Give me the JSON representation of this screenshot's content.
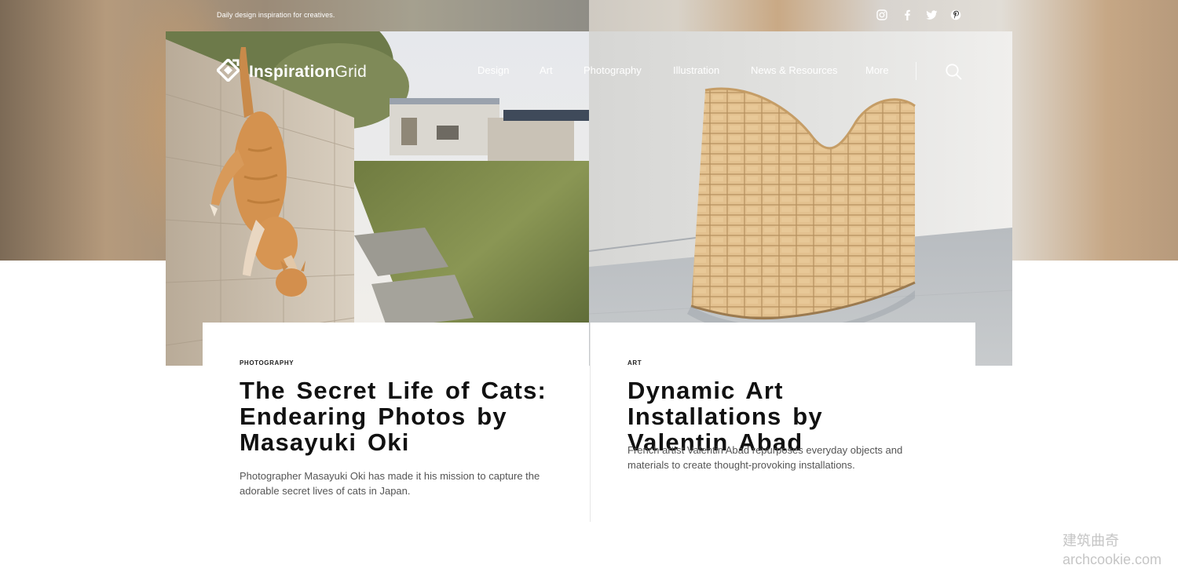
{
  "topbar": {
    "tagline": "Daily design inspiration for creatives.",
    "social": [
      {
        "icon": "instagram-icon"
      },
      {
        "icon": "facebook-icon"
      },
      {
        "icon": "twitter-icon"
      },
      {
        "icon": "pinterest-icon"
      }
    ]
  },
  "logo": {
    "bold": "Inspiration",
    "light": "Grid"
  },
  "nav": {
    "items": [
      "Design",
      "Art",
      "Photography",
      "Illustration",
      "News & Resources",
      "More"
    ],
    "search_icon": "search-icon"
  },
  "posts": [
    {
      "category": "Photography",
      "title": "The Secret Life of Cats: Endearing Photos by Masayuki Oki",
      "description": "Photographer Masayuki Oki has made it his mission to capture the adorable secret lives of cats in Japan."
    },
    {
      "category": "Art",
      "title": "Dynamic Art Installations by Valentin Abad",
      "description": "French artist Valentin Abad repurposes everyday objects and materials to create thought-provoking installations."
    }
  ],
  "watermark": {
    "line1": "建筑曲奇",
    "line2": "archcookie.com"
  },
  "colors": {
    "text": "#111111",
    "muted": "#555555",
    "white": "#ffffff"
  }
}
